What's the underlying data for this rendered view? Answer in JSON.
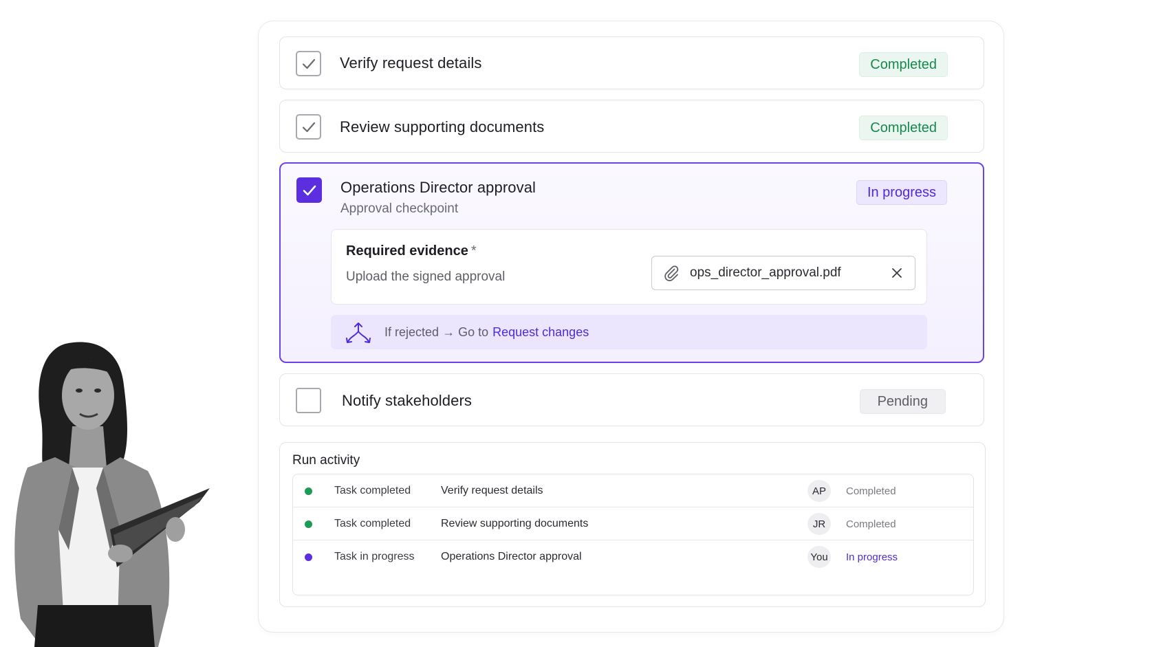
{
  "colors": {
    "accent": "#5b2ee0",
    "completed_text": "#16894e",
    "completed_bg": "#eaf6ef",
    "progress_bg": "#ece6ff",
    "pending_bg": "#f0f0f2",
    "dot_completed": "#1e9a57",
    "dot_progress": "#5b2ee0"
  },
  "tasks": [
    {
      "title": "Verify request details",
      "status": "Completed",
      "checked": true,
      "icon": "check-icon"
    },
    {
      "title": "Review supporting documents",
      "status": "Completed",
      "checked": true,
      "icon": "check-icon"
    },
    {
      "title": "Operations Director approval",
      "subtitle": "Approval checkpoint",
      "status": "In progress",
      "checked": true,
      "evidence": {
        "title": "Required evidence",
        "required_mark": "*",
        "description": "Upload the signed approval",
        "file_name": "ops_director_approval.pdf",
        "attach_icon": "paperclip-icon",
        "remove_icon": "close-icon"
      },
      "branch": {
        "icon": "branch-icon",
        "condition": "If rejected",
        "arrow": "→",
        "go_to": "Go to",
        "target": "Request changes"
      }
    },
    {
      "title": "Notify stakeholders",
      "status": "Pending",
      "checked": false
    }
  ],
  "activity": {
    "title": "Run activity",
    "rows": [
      {
        "event": "Task completed",
        "task": "Verify request details",
        "user": "AP",
        "status": "Completed"
      },
      {
        "event": "Task completed",
        "task": "Review supporting documents",
        "user": "JR",
        "status": "Completed"
      },
      {
        "event": "Task in progress",
        "task": "Operations Director approval",
        "user": "You",
        "status": "In progress"
      }
    ]
  }
}
